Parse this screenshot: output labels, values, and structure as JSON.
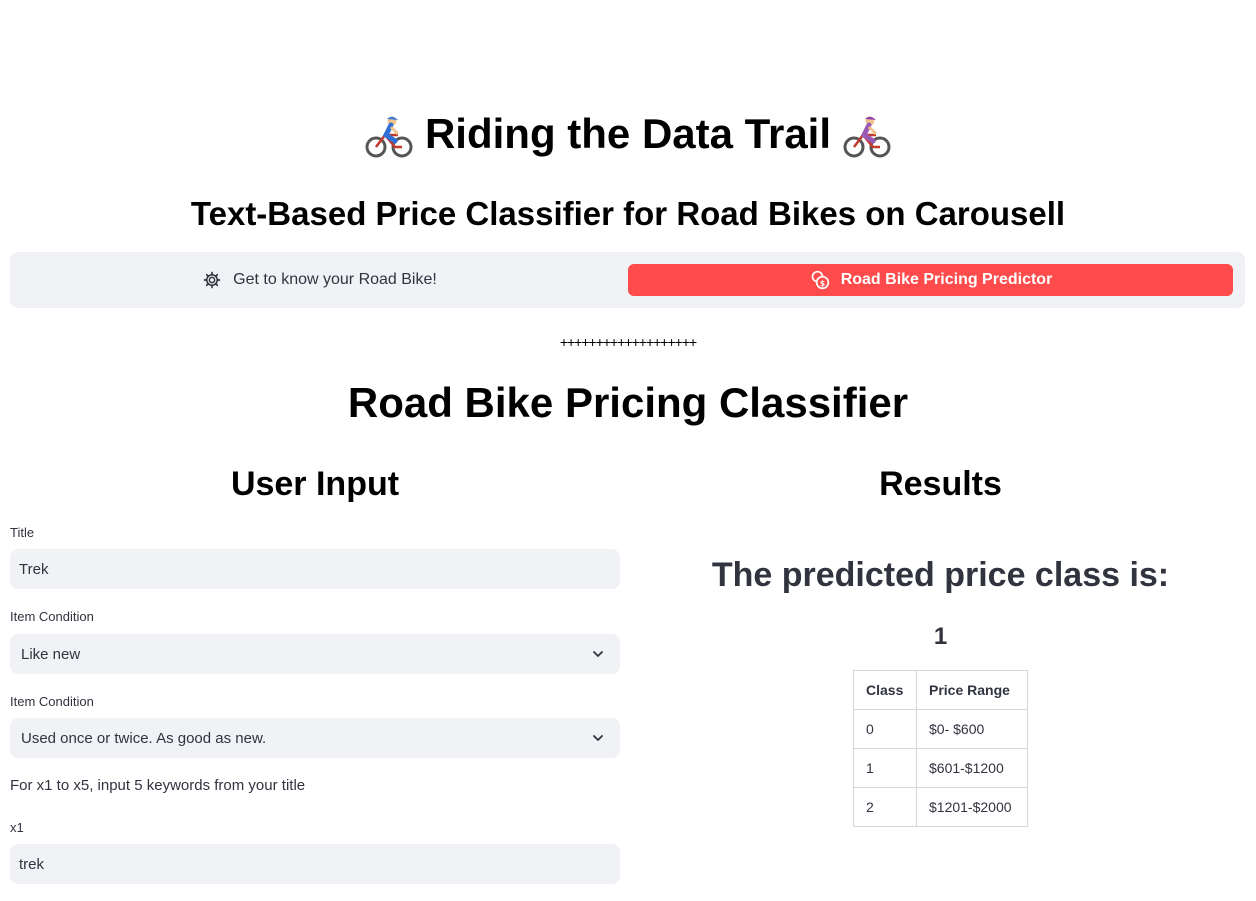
{
  "header": {
    "title": "Riding the Data Trail",
    "subtitle": "Text-Based Price Classifier for Road Bikes on Carousell"
  },
  "nav": {
    "items": [
      {
        "label": "Get to know your Road Bike!",
        "icon": "gear-icon",
        "active": false
      },
      {
        "label": "Road Bike Pricing Predictor",
        "icon": "coins-icon",
        "active": true
      }
    ],
    "active_color": "#ff4b4b"
  },
  "divider": "+++++++++++++++++++",
  "section_title": "Road Bike Pricing Classifier",
  "user_input": {
    "heading": "User Input",
    "title_label": "Title",
    "title_value": "Trek",
    "condition_label": "Item Condition",
    "condition_value": "Like new",
    "condition2_label": "Item Condition",
    "condition2_value": "Used once or twice. As good as new.",
    "instruction": "For x1 to x5, input 5 keywords from your title",
    "x1_label": "x1",
    "x1_value": "trek"
  },
  "results": {
    "heading": "Results",
    "prediction_text": "The predicted price class is:",
    "prediction_value": "1",
    "table": {
      "headers": [
        "Class",
        "Price Range"
      ],
      "rows": [
        [
          "0",
          "$0- $600"
        ],
        [
          "1",
          "$601-$1200"
        ],
        [
          "2",
          "$1201-$2000"
        ]
      ]
    }
  }
}
